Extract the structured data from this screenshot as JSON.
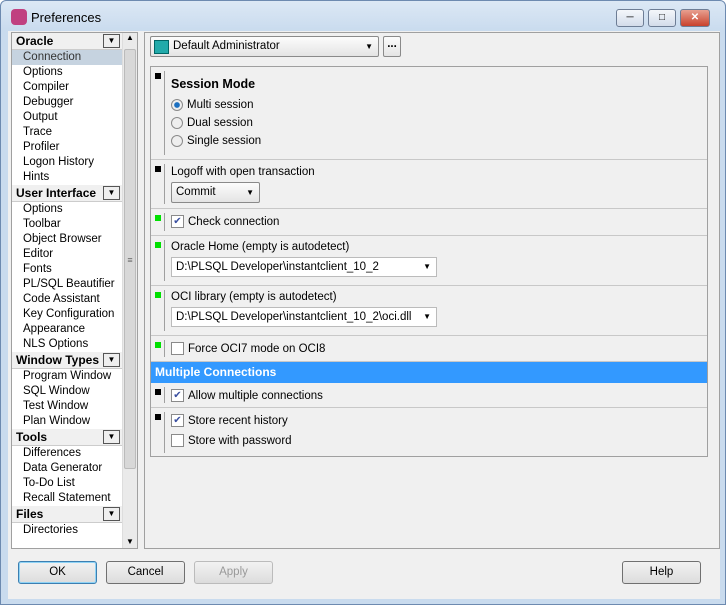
{
  "window": {
    "title": "Preferences",
    "min": "─",
    "max": "□",
    "close": "✕"
  },
  "sidebar": {
    "groups": [
      {
        "label": "Oracle",
        "items": [
          "Connection",
          "Options",
          "Compiler",
          "Debugger",
          "Output",
          "Trace",
          "Profiler",
          "Logon History",
          "Hints"
        ]
      },
      {
        "label": "User Interface",
        "items": [
          "Options",
          "Toolbar",
          "Object Browser",
          "Editor",
          "Fonts",
          "PL/SQL Beautifier",
          "Code Assistant",
          "Key Configuration",
          "Appearance",
          "NLS Options"
        ]
      },
      {
        "label": "Window Types",
        "items": [
          "Program Window",
          "SQL Window",
          "Test Window",
          "Plan Window"
        ]
      },
      {
        "label": "Tools",
        "items": [
          "Differences",
          "Data Generator",
          "To-Do List",
          "Recall Statement"
        ]
      },
      {
        "label": "Files",
        "items": [
          "Directories"
        ]
      }
    ],
    "selected": "Connection"
  },
  "profile": {
    "value": "Default Administrator",
    "more": "..."
  },
  "settings": {
    "session_mode": {
      "title": "Session Mode",
      "options": [
        "Multi session",
        "Dual session",
        "Single session"
      ],
      "selected": "Multi session"
    },
    "logoff": {
      "label": "Logoff with open transaction",
      "value": "Commit"
    },
    "check_connection": {
      "label": "Check connection",
      "checked": true
    },
    "oracle_home": {
      "label": "Oracle Home (empty is autodetect)",
      "value": "D:\\PLSQL Developer\\instantclient_10_2"
    },
    "oci_library": {
      "label": "OCI library (empty is autodetect)",
      "value": "D:\\PLSQL Developer\\instantclient_10_2\\oci.dll"
    },
    "force_oci7": {
      "label": "Force OCI7 mode on OCI8",
      "checked": false
    },
    "multiple_header": "Multiple Connections",
    "allow_multiple": {
      "label": "Allow multiple connections",
      "checked": true
    },
    "store_history": {
      "label": "Store recent history",
      "checked": true
    },
    "store_password": {
      "label": "Store with password",
      "checked": false
    }
  },
  "buttons": {
    "ok": "OK",
    "cancel": "Cancel",
    "apply": "Apply",
    "help": "Help"
  },
  "colors": {
    "section_header": "#3399ff",
    "changed_marker": "#00e000"
  }
}
